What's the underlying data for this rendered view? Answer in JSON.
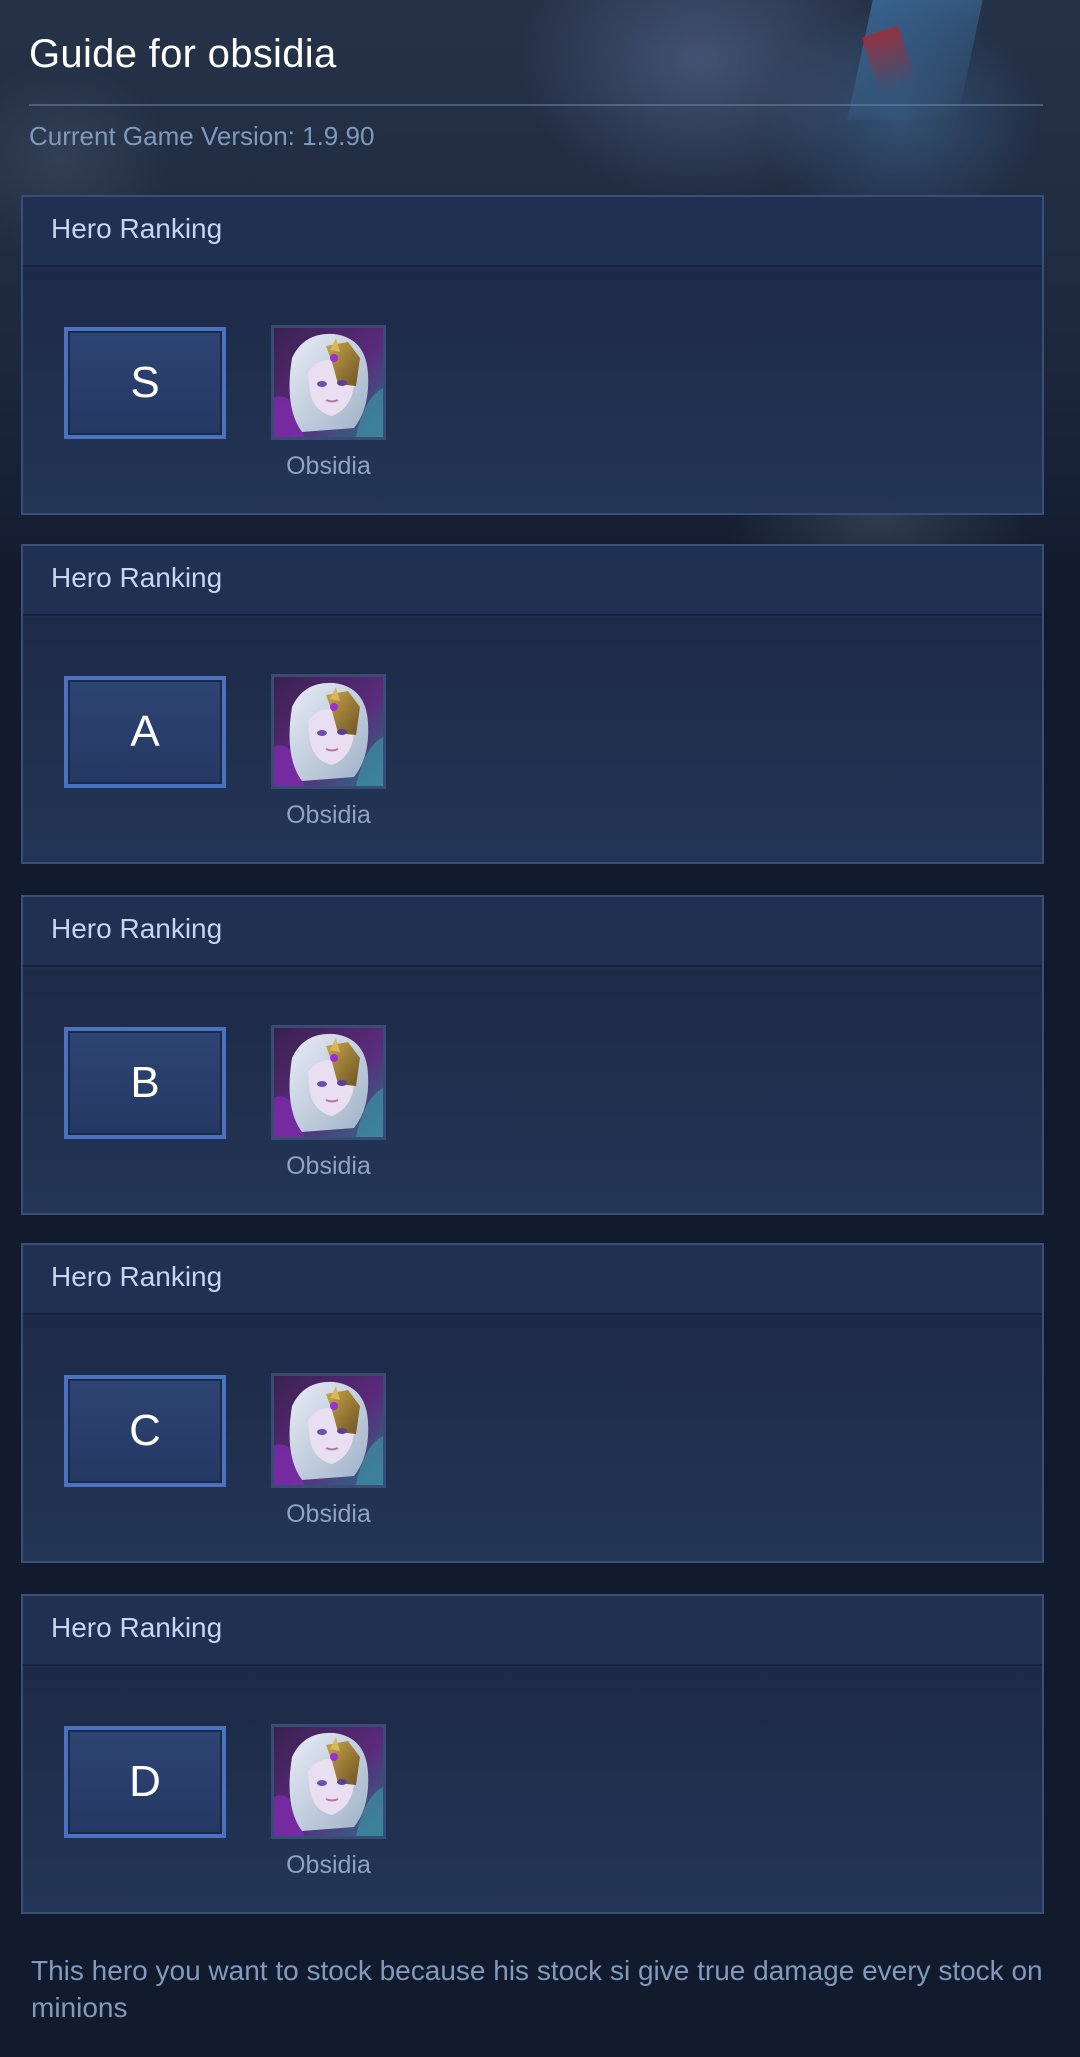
{
  "page": {
    "title": "Guide for obsidia",
    "version": "Current Game Version: 1.9.90"
  },
  "rankings": [
    {
      "header": "Hero Ranking",
      "tier": "S",
      "hero_name": "Obsidia",
      "hero_icon": "obsidia-portrait"
    },
    {
      "header": "Hero Ranking",
      "tier": "A",
      "hero_name": "Obsidia",
      "hero_icon": "obsidia-portrait"
    },
    {
      "header": "Hero Ranking",
      "tier": "B",
      "hero_name": "Obsidia",
      "hero_icon": "obsidia-portrait"
    },
    {
      "header": "Hero Ranking",
      "tier": "C",
      "hero_name": "Obsidia",
      "hero_icon": "obsidia-portrait"
    },
    {
      "header": "Hero Ranking",
      "tier": "D",
      "hero_name": "Obsidia",
      "hero_icon": "obsidia-portrait"
    }
  ],
  "footer": {
    "note": "This hero you want to stock because his stock si give true damage every stock on minions"
  },
  "colors": {
    "background": "#121b2d",
    "card_header": "#1f3053",
    "tier_border": "#4b72c0",
    "title_text": "#ffffff",
    "muted_text": "#7f99bc"
  }
}
